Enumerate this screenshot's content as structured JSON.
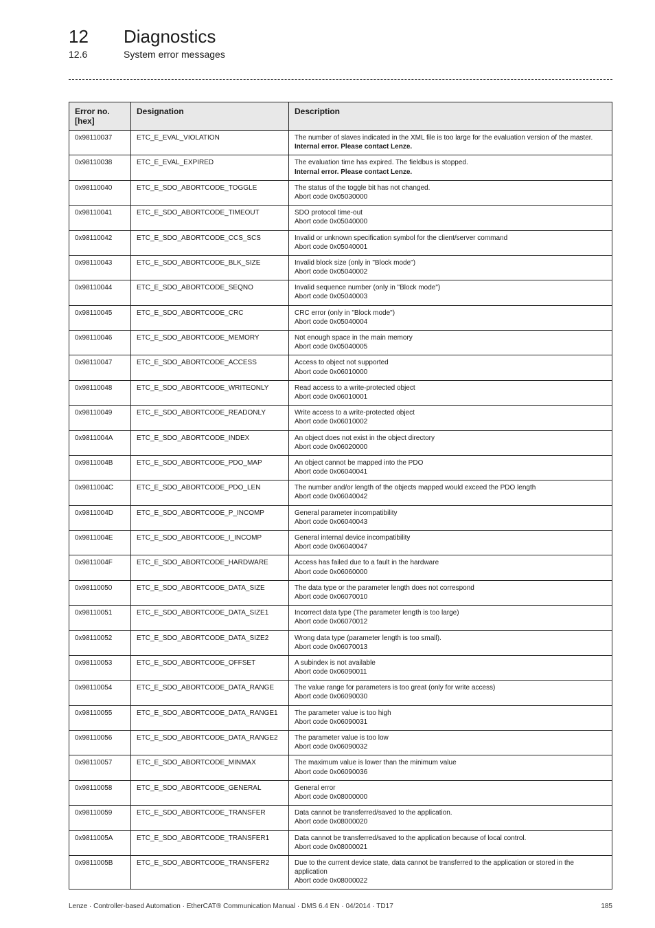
{
  "header": {
    "chapter_num": "12",
    "chapter_title": "Diagnostics",
    "section_num": "12.6",
    "section_title": "System error messages"
  },
  "table": {
    "headers": {
      "c1_l1": "Error no.",
      "c1_l2": "[hex]",
      "c2": "Designation",
      "c3": "Description"
    },
    "rows": [
      {
        "hex": "0x98110037",
        "des": "ETC_E_EVAL_VIOLATION",
        "d1": "The number of slaves indicated in the XML file is too large for the evaluation version of the master.",
        "d2b": "Internal error. Please contact Lenze."
      },
      {
        "hex": "0x98110038",
        "des": "ETC_E_EVAL_EXPIRED",
        "d1": "The evaluation time has expired. The fieldbus is stopped.",
        "d2b": "Internal error. Please contact Lenze."
      },
      {
        "hex": "0x98110040",
        "des": "ETC_E_SDO_ABORTCODE_TOGGLE",
        "d1": "The status of the toggle bit has not changed.",
        "d2": "Abort code 0x05030000"
      },
      {
        "hex": "0x98110041",
        "des": "ETC_E_SDO_ABORTCODE_TIMEOUT",
        "d1": "SDO protocol time-out",
        "d2": "Abort code 0x05040000"
      },
      {
        "hex": "0x98110042",
        "des": "ETC_E_SDO_ABORTCODE_CCS_SCS",
        "d1": "Invalid or unknown specification symbol for the client/server command",
        "d2": "Abort code 0x05040001"
      },
      {
        "hex": "0x98110043",
        "des": "ETC_E_SDO_ABORTCODE_BLK_SIZE",
        "d1": "Invalid block size (only in \"Block mode\")",
        "d2": "Abort code 0x05040002"
      },
      {
        "hex": "0x98110044",
        "des": "ETC_E_SDO_ABORTCODE_SEQNO",
        "d1": "Invalid sequence number (only in \"Block mode\")",
        "d2": "Abort code 0x05040003"
      },
      {
        "hex": "0x98110045",
        "des": "ETC_E_SDO_ABORTCODE_CRC",
        "d1": "CRC error (only in \"Block mode\")",
        "d2": "Abort code 0x05040004"
      },
      {
        "hex": "0x98110046",
        "des": "ETC_E_SDO_ABORTCODE_MEMORY",
        "d1": "Not enough space in the main memory",
        "d2": "Abort code 0x05040005"
      },
      {
        "hex": "0x98110047",
        "des": "ETC_E_SDO_ABORTCODE_ACCESS",
        "d1": "Access to object not supported",
        "d2": "Abort code 0x06010000"
      },
      {
        "hex": "0x98110048",
        "des": "ETC_E_SDO_ABORTCODE_WRITEONLY",
        "d1": "Read access to a write-protected object",
        "d2": "Abort code 0x06010001"
      },
      {
        "hex": "0x98110049",
        "des": "ETC_E_SDO_ABORTCODE_READONLY",
        "d1": "Write access to a write-protected object",
        "d2": "Abort code 0x06010002"
      },
      {
        "hex": "0x9811004A",
        "des": "ETC_E_SDO_ABORTCODE_INDEX",
        "d1": "An object does not exist in the object directory",
        "d2": "Abort code 0x06020000"
      },
      {
        "hex": "0x9811004B",
        "des": "ETC_E_SDO_ABORTCODE_PDO_MAP",
        "d1": "An object cannot be mapped into the PDO",
        "d2": "Abort code 0x06040041"
      },
      {
        "hex": "0x9811004C",
        "des": "ETC_E_SDO_ABORTCODE_PDO_LEN",
        "d1": "The number and/or length of the objects mapped would exceed the PDO length",
        "d2": "Abort code 0x06040042"
      },
      {
        "hex": "0x9811004D",
        "des": "ETC_E_SDO_ABORTCODE_P_INCOMP",
        "d1": "General parameter incompatibility",
        "d2": "Abort code 0x06040043"
      },
      {
        "hex": "0x9811004E",
        "des": "ETC_E_SDO_ABORTCODE_I_INCOMP",
        "d1": "General internal device incompatibility",
        "d2": "Abort code 0x06040047"
      },
      {
        "hex": "0x9811004F",
        "des": "ETC_E_SDO_ABORTCODE_HARDWARE",
        "d1": "Access has failed due to a fault in the hardware",
        "d2": "Abort code 0x06060000"
      },
      {
        "hex": "0x98110050",
        "des": "ETC_E_SDO_ABORTCODE_DATA_SIZE",
        "d1": "The data type or the parameter length does not correspond",
        "d2": "Abort code 0x06070010"
      },
      {
        "hex": "0x98110051",
        "des": "ETC_E_SDO_ABORTCODE_DATA_SIZE1",
        "d1": "Incorrect data type (The parameter length is too large)",
        "d2": "Abort code 0x06070012"
      },
      {
        "hex": "0x98110052",
        "des": "ETC_E_SDO_ABORTCODE_DATA_SIZE2",
        "d1": "Wrong data type (parameter length is too small).",
        "d2": "Abort code 0x06070013"
      },
      {
        "hex": "0x98110053",
        "des": "ETC_E_SDO_ABORTCODE_OFFSET",
        "d1": "A subindex is not available",
        "d2": "Abort code 0x06090011"
      },
      {
        "hex": "0x98110054",
        "des": "ETC_E_SDO_ABORTCODE_DATA_RANGE",
        "d1": "The value range for parameters is too great (only for write access)",
        "d2": "Abort code 0x06090030"
      },
      {
        "hex": "0x98110055",
        "des": "ETC_E_SDO_ABORTCODE_DATA_RANGE1",
        "d1": "The parameter value is too high",
        "d2": "Abort code 0x06090031"
      },
      {
        "hex": "0x98110056",
        "des": "ETC_E_SDO_ABORTCODE_DATA_RANGE2",
        "d1": "The parameter value is too low",
        "d2": "Abort code 0x06090032"
      },
      {
        "hex": "0x98110057",
        "des": "ETC_E_SDO_ABORTCODE_MINMAX",
        "d1": "The maximum value is lower than the minimum value",
        "d2": "Abort code 0x06090036"
      },
      {
        "hex": "0x98110058",
        "des": "ETC_E_SDO_ABORTCODE_GENERAL",
        "d1": "General error",
        "d2": "Abort code 0x08000000"
      },
      {
        "hex": "0x98110059",
        "des": "ETC_E_SDO_ABORTCODE_TRANSFER",
        "d1": "Data cannot be transferred/saved to the application.",
        "d2": "Abort code 0x08000020"
      },
      {
        "hex": "0x9811005A",
        "des": "ETC_E_SDO_ABORTCODE_TRANSFER1",
        "d1": "Data cannot be transferred/saved to the application because of local control.",
        "d2": "Abort code 0x08000021"
      },
      {
        "hex": "0x9811005B",
        "des": "ETC_E_SDO_ABORTCODE_TRANSFER2",
        "d1": "Due to the current device state, data cannot be transferred to the application or stored in the application",
        "d2": "Abort code 0x08000022"
      }
    ]
  },
  "footer": {
    "left": "Lenze · Controller-based Automation · EtherCAT® Communication Manual · DMS 6.4 EN · 04/2014 · TD17",
    "right": "185"
  }
}
